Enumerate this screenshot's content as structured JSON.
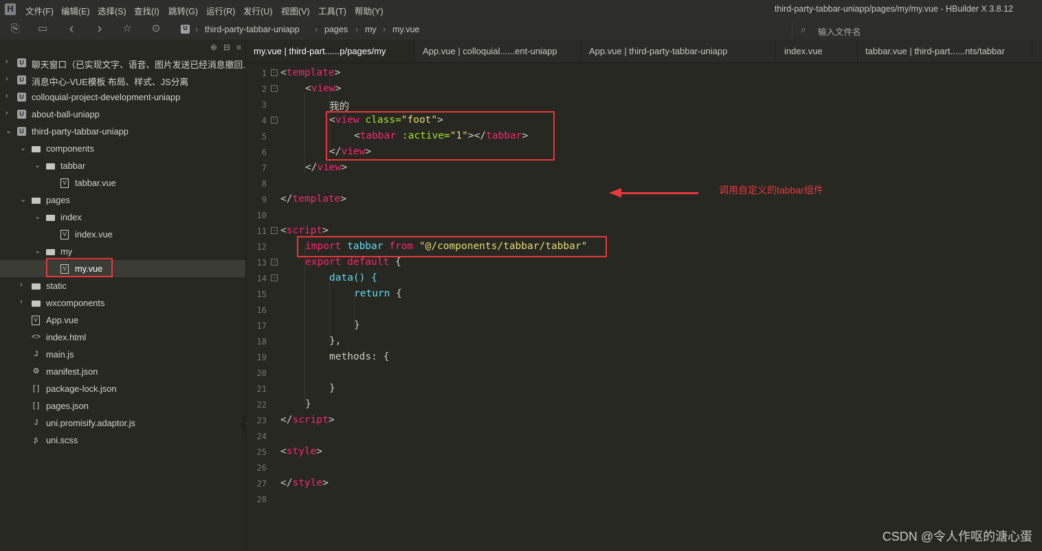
{
  "window": {
    "title": "third-party-tabbar-uniapp/pages/my/my.vue - HBuilder X 3.8.12",
    "menu": [
      "文件(F)",
      "编辑(E)",
      "选择(S)",
      "查找(I)",
      "跳转(G)",
      "运行(R)",
      "发行(U)",
      "视图(V)",
      "工具(T)",
      "帮助(Y)"
    ]
  },
  "toolbar": {
    "breadcrumb": [
      "third-party-tabbar-uniapp",
      "pages",
      "my",
      "my.vue"
    ],
    "file_search_placeholder": "输入文件名"
  },
  "tree": [
    {
      "label": "聊天窗口（已实现文字、语音、图片发送已经消息撤回...",
      "icon": "u-project-icon",
      "arrow": "›"
    },
    {
      "label": "消息中心-VUE模板 布局、样式、JS分离",
      "icon": "u-project-icon",
      "arrow": "›"
    },
    {
      "label": "colloquial-project-development-uniapp",
      "icon": "u-project-icon",
      "arrow": "›"
    },
    {
      "label": "about-ball-uniapp",
      "icon": "u-project-icon",
      "arrow": "›"
    },
    {
      "label": "third-party-tabbar-uniapp",
      "icon": "u-project-icon",
      "arrow": "⌄"
    },
    {
      "label": "components",
      "icon": "folder-icon",
      "arrow": "⌄"
    },
    {
      "label": "tabbar",
      "icon": "folder-icon",
      "arrow": "⌄"
    },
    {
      "label": "tabbar.vue",
      "icon": "vue-file-icon",
      "arrow": ""
    },
    {
      "label": "pages",
      "icon": "folder-icon",
      "arrow": "⌄"
    },
    {
      "label": "index",
      "icon": "folder-icon",
      "arrow": "⌄"
    },
    {
      "label": "index.vue",
      "icon": "vue-file-icon",
      "arrow": ""
    },
    {
      "label": "my",
      "icon": "folder-icon",
      "arrow": "⌄"
    },
    {
      "label": "my.vue",
      "icon": "vue-file-icon",
      "arrow": ""
    },
    {
      "label": "static",
      "icon": "folder-icon",
      "arrow": "›"
    },
    {
      "label": "wxcomponents",
      "icon": "folder-icon",
      "arrow": "›"
    },
    {
      "label": "App.vue",
      "icon": "vue-file-icon",
      "arrow": ""
    },
    {
      "label": "index.html",
      "icon": "html-file-icon",
      "arrow": ""
    },
    {
      "label": "main.js",
      "icon": "js-file-icon",
      "arrow": ""
    },
    {
      "label": "manifest.json",
      "icon": "manifest-file-icon",
      "arrow": ""
    },
    {
      "label": "package-lock.json",
      "icon": "json-file-icon",
      "arrow": ""
    },
    {
      "label": "pages.json",
      "icon": "json-file-icon",
      "arrow": ""
    },
    {
      "label": "uni.promisify.adaptor.js",
      "icon": "js-file-icon",
      "arrow": ""
    },
    {
      "label": "uni.scss",
      "icon": "scss-file-icon",
      "arrow": ""
    }
  ],
  "tabs": [
    {
      "label": "my.vue | third-part......p/pages/my"
    },
    {
      "label": "App.vue | colloquial......ent-uniapp"
    },
    {
      "label": "App.vue | third-party-tabbar-uniapp"
    },
    {
      "label": "index.vue"
    },
    {
      "label": "tabbar.vue | third-part......nts/tabbar"
    }
  ],
  "code": {
    "line_numbers": [
      "1",
      "2",
      "3",
      "4",
      "5",
      "6",
      "7",
      "8",
      "9",
      "10",
      "11",
      "12",
      "13",
      "14",
      "15",
      "16",
      "17",
      "18",
      "19",
      "20",
      "21",
      "22",
      "23",
      "24",
      "25",
      "26",
      "27",
      "28"
    ],
    "l1_open": "<",
    "l1_tag": "template",
    "l1_close": ">",
    "l2_open": "<",
    "l2_tag": "view",
    "l2_close": ">",
    "l3_text": "我的",
    "l4_open": "<",
    "l4_tag": "view",
    "l4_attr": " class=",
    "l4_val": "\"foot\"",
    "l4_close": ">",
    "l5_open": "<",
    "l5_tag": "tabbar",
    "l5_attr": " :active=",
    "l5_val": "\"1\"",
    "l5_mid": "></",
    "l5_tag2": "tabbar",
    "l5_close": ">",
    "l6_open": "</",
    "l6_tag": "view",
    "l6_close": ">",
    "l7_open": "</",
    "l7_tag": "view",
    "l7_close": ">",
    "l9_open": "</",
    "l9_tag": "template",
    "l9_close": ">",
    "l11_open": "<",
    "l11_tag": "script",
    "l11_close": ">",
    "l12_kw": "import",
    "l12_name": " tabbar ",
    "l12_from": "from",
    "l12_str": " \"@/components/tabbar/tabbar\"",
    "l13_kw": "export",
    "l13_kw2": " default",
    "l13_brace": " {",
    "l14_text": "data() {",
    "l15_kw": "return",
    "l15_brace": " {",
    "l17_text": "}",
    "l18_text": "},",
    "l19_text": "methods: {",
    "l21_text": "}",
    "l22_text": "}",
    "l23_open": "</",
    "l23_tag": "script",
    "l23_close": ">",
    "l25_open": "<",
    "l25_tag": "style",
    "l25_close": ">",
    "l27_open": "</",
    "l27_tag": "style",
    "l27_close": ">"
  },
  "annotation": {
    "text": "调用自定义的tabbar组件",
    "color": "#e8383d"
  },
  "watermark": "CSDN @令人作呕的溏心蛋"
}
